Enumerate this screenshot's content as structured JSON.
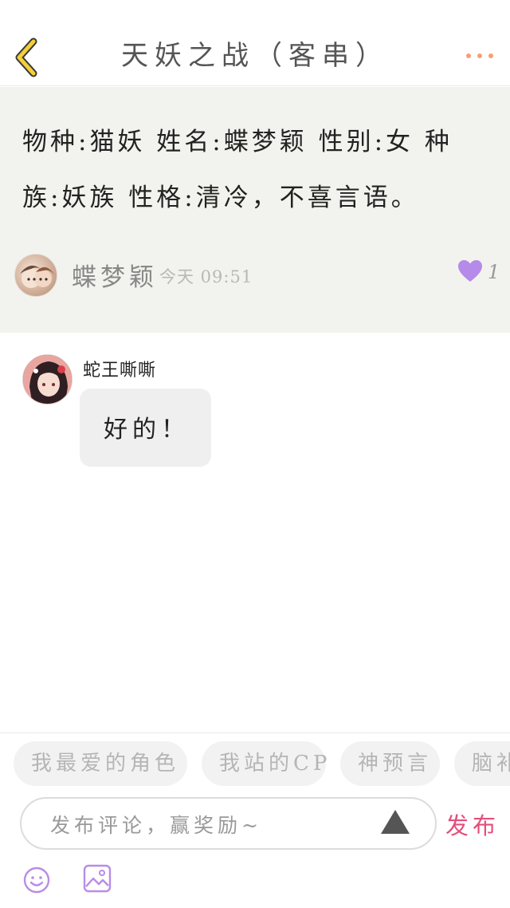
{
  "header": {
    "title": "天妖之战（客串）"
  },
  "post": {
    "content": "物种:猫妖 姓名:蝶梦颖 性别:女 种族:妖族 性格:清冷，不喜言语。",
    "author": "蝶梦颖",
    "time": "今天 09:51",
    "like_count": "1"
  },
  "comments": [
    {
      "author": "蛇王嘶嘶",
      "text": "好的！"
    }
  ],
  "tags": [
    "我最爱的角色",
    "我站的CP",
    "神预言",
    "脑补"
  ],
  "composer": {
    "placeholder": "发布评论，赢奖励~",
    "publish_label": "发布"
  },
  "colors": {
    "accent_back": "#f5cf37",
    "more_dots": "#f6a06f",
    "like_heart": "#b58ae8",
    "publish": "#e54e7a",
    "toolbar_icons": "#b88de6"
  },
  "icons": {
    "back": "chevron-left-icon",
    "more": "more-dots-icon",
    "like": "heart-icon",
    "send": "triangle-send-icon",
    "emoji": "smiley-icon",
    "image": "image-icon"
  }
}
